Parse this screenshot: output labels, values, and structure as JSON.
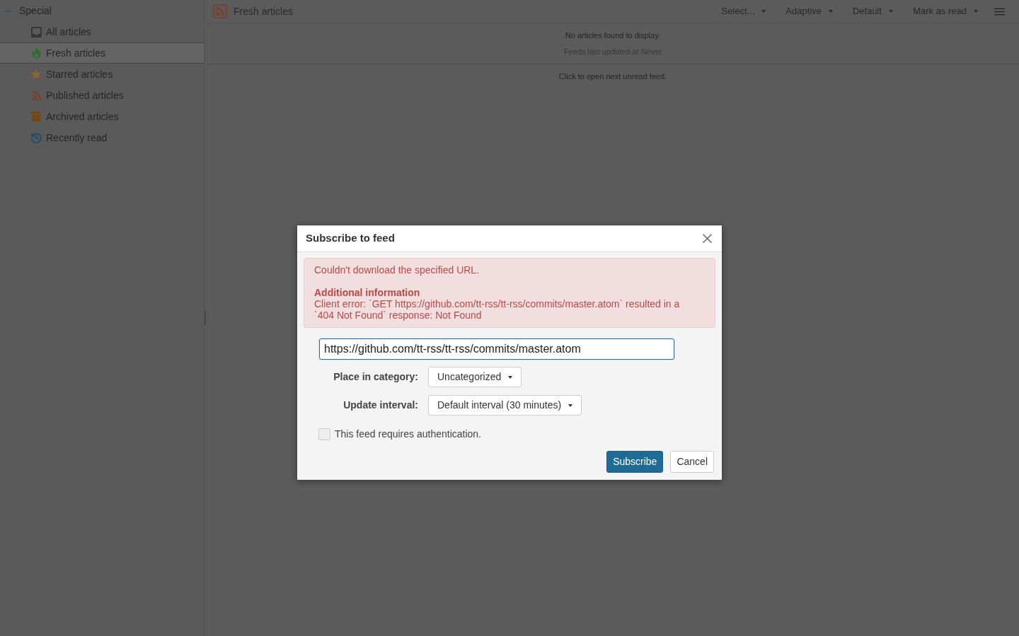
{
  "sidebar": {
    "category": {
      "label": "Special",
      "expanded": true
    },
    "items": [
      {
        "kind": "all",
        "label": "All articles",
        "selected": false
      },
      {
        "kind": "fresh",
        "label": "Fresh articles",
        "selected": true
      },
      {
        "kind": "starred",
        "label": "Starred articles",
        "selected": false
      },
      {
        "kind": "published",
        "label": "Published articles",
        "selected": false
      },
      {
        "kind": "archived",
        "label": "Archived articles",
        "selected": false
      },
      {
        "kind": "recent",
        "label": "Recently read",
        "selected": false
      }
    ]
  },
  "header": {
    "title": "Fresh articles",
    "toolbar": [
      {
        "label": "Select..."
      },
      {
        "label": "Adaptive"
      },
      {
        "label": "Default"
      },
      {
        "label": "Mark as read"
      }
    ]
  },
  "content": {
    "message": "No articles found to display.",
    "last_updated": "Feeds last updated at Never",
    "next_unread": "Click to open next unread feed."
  },
  "dialog": {
    "title": "Subscribe to feed",
    "error": {
      "message": "Couldn't download the specified URL.",
      "details_title": "Additional information",
      "details": "Client error: `GET https://github.com/tt-rss/tt-rss/commits/master.atom` resulted in a `404 Not Found` response: Not Found"
    },
    "url_field": {
      "value": "https://github.com/tt-rss/tt-rss/commits/master.atom",
      "focused": true
    },
    "fields": [
      {
        "label": "Place in category:",
        "value": "Uncategorized"
      },
      {
        "label": "Update interval:",
        "value": "Default interval (30 minutes)"
      }
    ],
    "auth": {
      "label": "This feed requires authentication.",
      "checked": false
    },
    "buttons": [
      {
        "kind": "primary",
        "label": "Subscribe"
      },
      {
        "kind": "secondary",
        "label": "Cancel"
      }
    ]
  }
}
